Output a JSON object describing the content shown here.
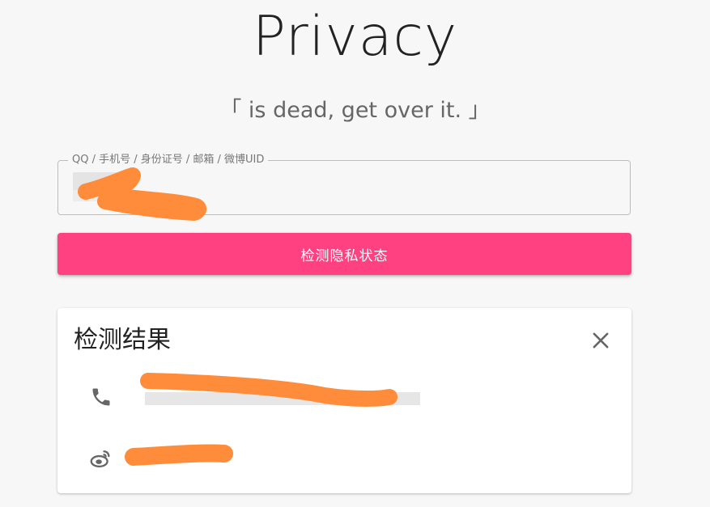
{
  "header": {
    "title": "Privacy",
    "subtitle": "「 is dead, get over it. 」"
  },
  "search": {
    "label": "QQ / 手机号 / 身份证号 / 邮箱 / 微博UID",
    "value": ""
  },
  "submit": {
    "label": "检测隐私状态"
  },
  "result": {
    "title": "检测结果",
    "items": [
      {
        "icon": "phone-icon",
        "value": ""
      },
      {
        "icon": "weibo-icon",
        "value": ""
      }
    ]
  },
  "colors": {
    "accent": "#ff4081",
    "redaction": "#ff8c3a",
    "background": "#f7f7f7"
  }
}
